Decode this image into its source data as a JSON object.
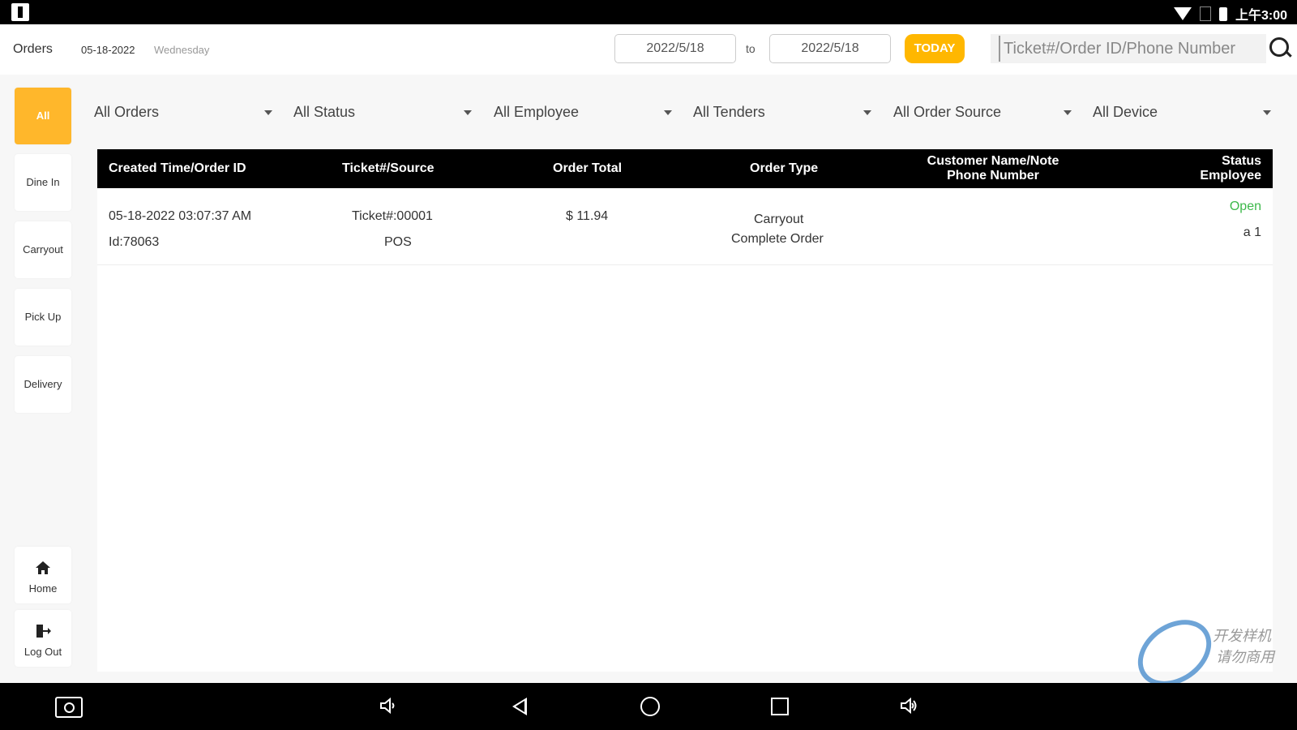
{
  "status_bar": {
    "time": "上午3:00"
  },
  "header": {
    "title": "Orders",
    "date": "05-18-2022",
    "weekday": "Wednesday",
    "date_from": "2022/5/18",
    "to_label": "to",
    "date_to": "2022/5/18",
    "today_label": "TODAY",
    "search_placeholder": "Ticket#/Order ID/Phone Number"
  },
  "sidebar": {
    "items": [
      {
        "label": "All",
        "active": true
      },
      {
        "label": "Dine In"
      },
      {
        "label": "Carryout"
      },
      {
        "label": "Pick Up"
      },
      {
        "label": "Delivery"
      }
    ],
    "home_label": "Home",
    "logout_label": "Log Out"
  },
  "filters": [
    "All Orders",
    "All Status",
    "All Employee",
    "All Tenders",
    "All Order Source",
    "All Device"
  ],
  "table": {
    "headers": {
      "created": "Created Time/Order ID",
      "ticket": "Ticket#/Source",
      "total": "Order Total",
      "type": "Order Type",
      "customer_1": "Customer Name/Note",
      "customer_2": "Phone Number",
      "status_1": "Status",
      "status_2": "Employee"
    },
    "rows": [
      {
        "created_time": "05-18-2022 03:07:37 AM",
        "order_id": "Id:78063",
        "ticket": "Ticket#:00001",
        "source": "POS",
        "total": "$ 11.94",
        "type": "Carryout",
        "type_detail": "Complete Order",
        "status": "Open",
        "employee": "a 1"
      }
    ]
  },
  "watermark": {
    "line1": "开发样机",
    "line2": "请勿商用"
  },
  "colors": {
    "accent": "#ffb700",
    "open_status": "#3cb84a",
    "header_bg": "#000000"
  },
  "icons": [
    "search-icon",
    "home-icon",
    "logout-icon",
    "camera-icon",
    "volume-down-icon",
    "back-icon",
    "home-nav-icon",
    "recents-icon",
    "volume-up-icon",
    "wifi-icon",
    "battery-icon"
  ]
}
